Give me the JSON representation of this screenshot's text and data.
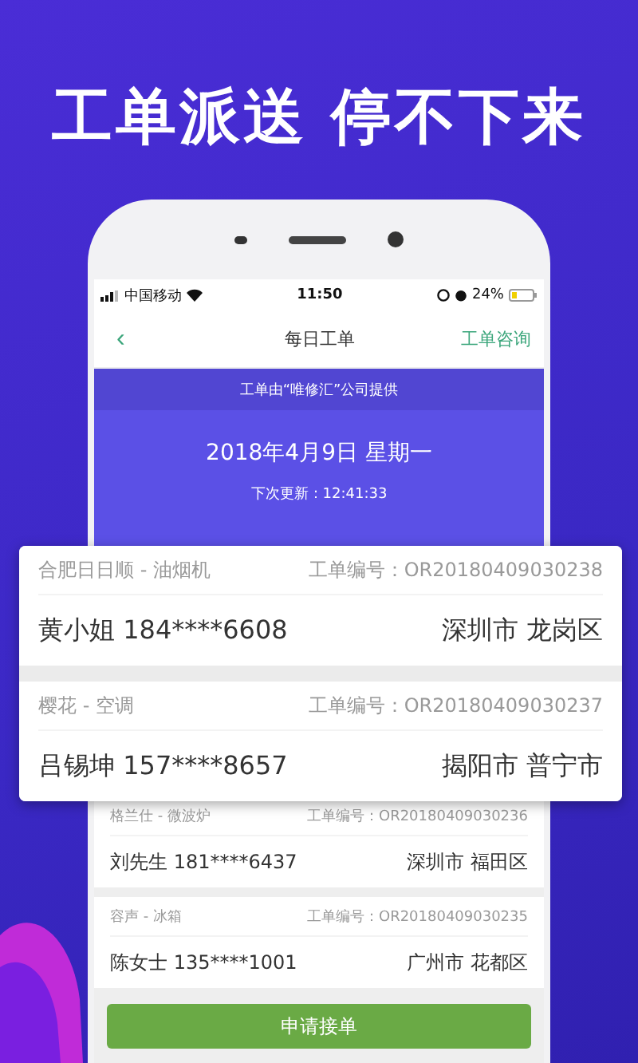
{
  "headline": "工单派送 停不下来",
  "status_bar": {
    "carrier": "中国移动",
    "time": "11:50",
    "battery": "24%"
  },
  "nav": {
    "back": "‹",
    "title": "每日工单",
    "action": "工单咨询"
  },
  "banner": {
    "provider": "工单由“唯修汇”公司提供",
    "date": "2018年4月9日 星期一",
    "next_update": "下次更新：12:41:33"
  },
  "featured_orders": [
    {
      "product": "合肥日日顺 - 油烟机",
      "order_no": "工单编号：OR20180409030238",
      "customer": "黄小姐 184****6608",
      "area": "深圳市 龙岗区"
    },
    {
      "product": "樱花 - 空调",
      "order_no": "工单编号：OR20180409030237",
      "customer": "吕锡坤 157****8657",
      "area": "揭阳市 普宁市"
    }
  ],
  "orders": [
    {
      "product": "格兰仕 - 微波炉",
      "order_no": "工单编号：OR20180409030236",
      "customer": "刘先生 181****6437",
      "area": "深圳市 福田区"
    },
    {
      "product": "容声 - 冰箱",
      "order_no": "工单编号：OR20180409030235",
      "customer": "陈女士 135****1001",
      "area": "广州市 花都区"
    }
  ],
  "apply_button": "申请接单"
}
